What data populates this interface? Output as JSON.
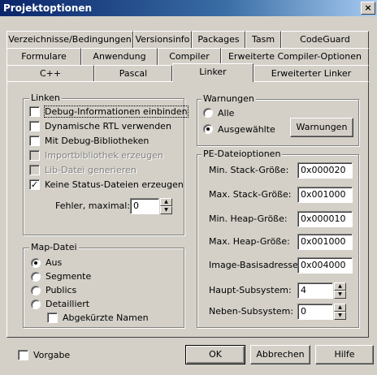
{
  "window": {
    "title": "Projektoptionen",
    "close_glyph": "×"
  },
  "tabs_row1": [
    {
      "label": "Verzeichnisse/Bedingungen"
    },
    {
      "label": "Versionsinfo"
    },
    {
      "label": "Packages"
    },
    {
      "label": "Tasm"
    },
    {
      "label": "CodeGuard"
    }
  ],
  "tabs_row2": [
    {
      "label": "Formulare"
    },
    {
      "label": "Anwendung"
    },
    {
      "label": "Compiler"
    },
    {
      "label": "Erweiterte Compiler-Optionen"
    }
  ],
  "tabs_row3": [
    {
      "label": "C++"
    },
    {
      "label": "Pascal"
    },
    {
      "label": "Linker",
      "active": true
    },
    {
      "label": "Erweiterter Linker"
    }
  ],
  "linken": {
    "title": "Linken",
    "options": [
      {
        "label": "Debug-Informationen einbinden",
        "checked": false,
        "enabled": true
      },
      {
        "label": "Dynamische RTL verwenden",
        "checked": false,
        "enabled": true
      },
      {
        "label": "Mit Debug-Bibliotheken",
        "checked": false,
        "enabled": true
      },
      {
        "label": "Importbibliothek erzeugen",
        "checked": false,
        "enabled": false
      },
      {
        "label": "Lib-Datei generieren",
        "checked": false,
        "enabled": false
      },
      {
        "label": "Keine Status-Dateien erzeugen",
        "checked": true,
        "enabled": true
      }
    ],
    "fehler_label": "Fehler, maximal:",
    "fehler_value": "0",
    "check_glyph": "✓"
  },
  "warnungen": {
    "title": "Warnungen",
    "radio_alle": "Alle",
    "radio_ausgewaehlte": "Ausgewählte",
    "button": "Warnungen"
  },
  "pe": {
    "title": "PE-Dateioptionen",
    "fields": [
      {
        "label": "Min. Stack-Größe:",
        "value": "0x000020"
      },
      {
        "label": "Max. Stack-Größe:",
        "value": "0x001000"
      },
      {
        "label": "Min. Heap-Größe:",
        "value": "0x000010"
      },
      {
        "label": "Max. Heap-Größe:",
        "value": "0x001000"
      },
      {
        "label": "Image-Basisadresse:",
        "value": "0x004000"
      }
    ],
    "haupt_label": "Haupt-Subsystem:",
    "haupt_value": "4",
    "neben_label": "Neben-Subsystem:",
    "neben_value": "0"
  },
  "map": {
    "title": "Map-Datei",
    "options": [
      {
        "label": "Aus",
        "selected": true
      },
      {
        "label": "Segmente",
        "selected": false
      },
      {
        "label": "Publics",
        "selected": false
      },
      {
        "label": "Detailliert",
        "selected": false
      }
    ],
    "abgekuerzt": "Abgekürzte Namen"
  },
  "footer": {
    "vorgabe": "Vorgabe",
    "ok": "OK",
    "abbrechen": "Abbrechen",
    "hilfe": "Hilfe"
  }
}
